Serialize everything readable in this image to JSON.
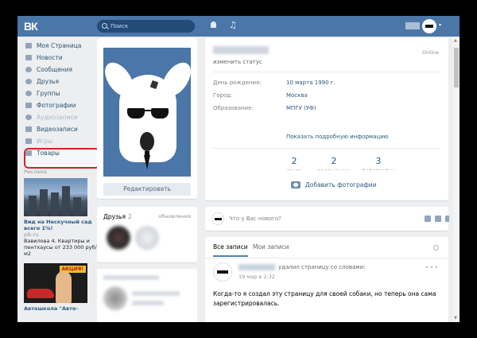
{
  "topbar": {
    "logo": "ВК",
    "search_placeholder": "Поиск",
    "icons": [
      "search-icon",
      "bell-icon",
      "music-icon",
      "chevron-down-icon"
    ],
    "music_glyph": "♫",
    "caret_glyph": "▾"
  },
  "sidebar": {
    "items": [
      {
        "label": "Моя Страница",
        "icon": "home-icon"
      },
      {
        "label": "Новости",
        "icon": "news-icon"
      },
      {
        "label": "Сообщения",
        "icon": "messages-icon"
      },
      {
        "label": "Друзья",
        "icon": "friends-icon"
      },
      {
        "label": "Группы",
        "icon": "groups-icon"
      },
      {
        "label": "Фотографии",
        "icon": "camera-icon"
      },
      {
        "label": "Аудиозаписи",
        "icon": "audio-icon"
      },
      {
        "label": "Видеозаписи",
        "icon": "video-icon"
      },
      {
        "label": "Игры",
        "icon": "games-icon"
      },
      {
        "label": "Товары",
        "icon": "goods-icon"
      }
    ],
    "ad_label": "Реклама",
    "ad1": {
      "title": "Вид на Нескучный сад всего 1%!",
      "site": "pik.ru",
      "text": "Вавилова 4. Квартиры и пентхаусы от 233 000 руб/м2"
    },
    "ad2": {
      "badge": "АКЦИЯ!",
      "title": "Автошкола \"Авто-"
    }
  },
  "profile": {
    "edit_button": "Редактировать",
    "status_link": "изменить статус",
    "online": "Online",
    "rows": [
      {
        "label": "День рождения:",
        "value": "10 марта 1990 г."
      },
      {
        "label": "Город:",
        "value": "Москва"
      },
      {
        "label": "Образование:",
        "value": "МПГУ (УФ)"
      }
    ],
    "more_link": "Показать подробную информацию",
    "counters": [
      {
        "n": "2",
        "l": "друга"
      },
      {
        "n": "2",
        "l": "подписчика"
      },
      {
        "n": "3",
        "l": "фотографии"
      }
    ],
    "add_photos": "Добавить фотографии"
  },
  "friends": {
    "title": "Друзья",
    "count": "2",
    "updates": "обновления"
  },
  "composer": {
    "placeholder": "Что у Вас нового?"
  },
  "wall": {
    "tabs": [
      "Все записи",
      "Мои записи"
    ],
    "post": {
      "action": "удалил страницу со словами:",
      "time": "19 мар в 2:32",
      "menu": "•••",
      "text": "Когда-то я создал эту страницу для своей собаки, но теперь она сама зарегистрировалась."
    }
  },
  "colors": {
    "header": "#4a76a8",
    "link": "#2a5885",
    "highlight": "#d2232a"
  }
}
